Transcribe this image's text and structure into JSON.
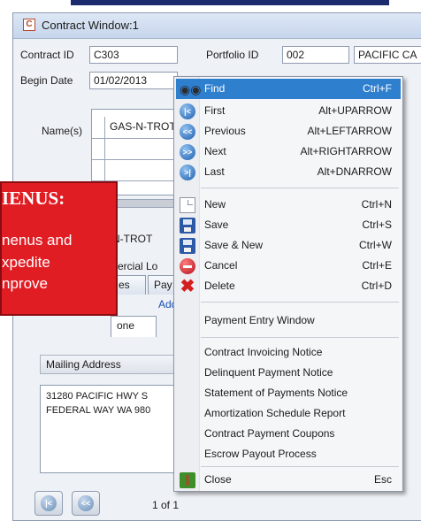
{
  "window": {
    "title": "Contract Window:1"
  },
  "fields": {
    "contract_id": {
      "label": "Contract ID",
      "value": "C303"
    },
    "portfolio_id": {
      "label": "Portfolio ID",
      "value": "002",
      "name_value": "PACIFIC CA"
    },
    "begin_date": {
      "label": "Begin Date",
      "value": "01/02/2013"
    },
    "names": {
      "label": "Name(s)",
      "value": "GAS-N-TROT"
    }
  },
  "body": {
    "name_line": "-N-TROT",
    "type_line": "mercial Lo",
    "tabs": [
      "es",
      "Pay"
    ],
    "add_link": "Add",
    "phone_tab": "one",
    "mailing_label": "Mailing Address",
    "address_lines": [
      "31280 PACIFIC HWY S",
      "FEDERAL WAY WA 980"
    ],
    "page_count": "1 of 1"
  },
  "callout": {
    "title": "IENUS:",
    "lines": [
      "nenus and",
      "xpedite",
      "nprove"
    ],
    "color": "#e11d24"
  },
  "menu": {
    "highlight_color": "#2f7fcf",
    "items": [
      {
        "label": "Find",
        "shortcut": "Ctrl+F",
        "icon": "binoculars-icon"
      },
      {
        "label": "First",
        "shortcut": "Alt+UPARROW",
        "icon": "first-record-icon"
      },
      {
        "label": "Previous",
        "shortcut": "Alt+LEFTARROW",
        "icon": "previous-record-icon"
      },
      {
        "label": "Next",
        "shortcut": "Alt+RIGHTARROW",
        "icon": "next-record-icon"
      },
      {
        "label": "Last",
        "shortcut": "Alt+DNARROW",
        "icon": "last-record-icon"
      },
      {
        "label": "New",
        "shortcut": "Ctrl+N",
        "icon": "new-document-icon"
      },
      {
        "label": "Save",
        "shortcut": "Ctrl+S",
        "icon": "save-disk-icon"
      },
      {
        "label": "Save & New",
        "shortcut": "Ctrl+W",
        "icon": "save-new-icon"
      },
      {
        "label": "Cancel",
        "shortcut": "Ctrl+E",
        "icon": "cancel-icon"
      },
      {
        "label": "Delete",
        "shortcut": "Ctrl+D",
        "icon": "delete-x-icon"
      },
      {
        "label": "Payment Entry Window"
      },
      {
        "label": "Contract Invoicing Notice"
      },
      {
        "label": "Delinquent Payment Notice"
      },
      {
        "label": "Statement of Payments Notice"
      },
      {
        "label": "Amortization Schedule Report"
      },
      {
        "label": "Contract Payment Coupons"
      },
      {
        "label": "Escrow Payout Process"
      },
      {
        "label": "Close",
        "shortcut": "Esc",
        "icon": "close-door-icon"
      }
    ]
  }
}
